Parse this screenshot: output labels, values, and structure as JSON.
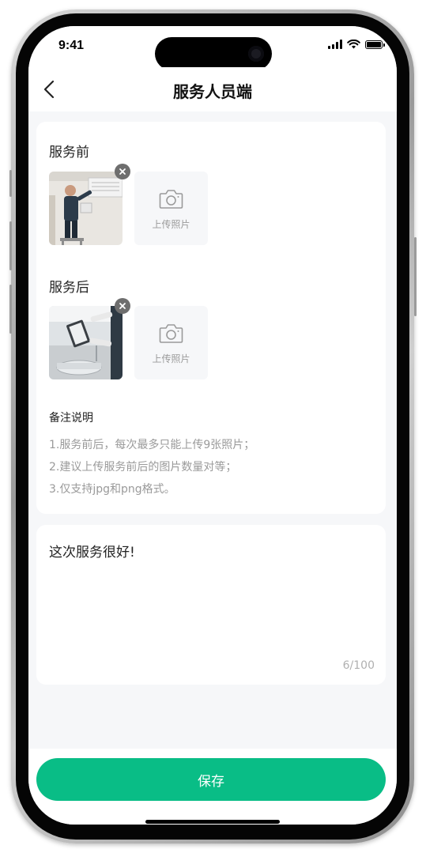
{
  "status_bar": {
    "time": "9:41"
  },
  "nav": {
    "title": "服务人员端"
  },
  "before_section": {
    "title": "服务前",
    "upload_label": "上传照片"
  },
  "after_section": {
    "title": "服务后",
    "upload_label": "上传照片"
  },
  "notes": {
    "title": "备注说明",
    "lines": [
      "1.服务前后，每次最多只能上传9张照片；",
      "2.建议上传服务前后的图片数量对等；",
      "3.仅支持jpg和png格式。"
    ]
  },
  "remark": {
    "text": "这次服务很好!",
    "count": "6/100"
  },
  "footer": {
    "save_label": "保存"
  },
  "colors": {
    "accent": "#09bd86",
    "page_bg": "#f6f7f9",
    "muted_text": "#9a9a9a"
  }
}
